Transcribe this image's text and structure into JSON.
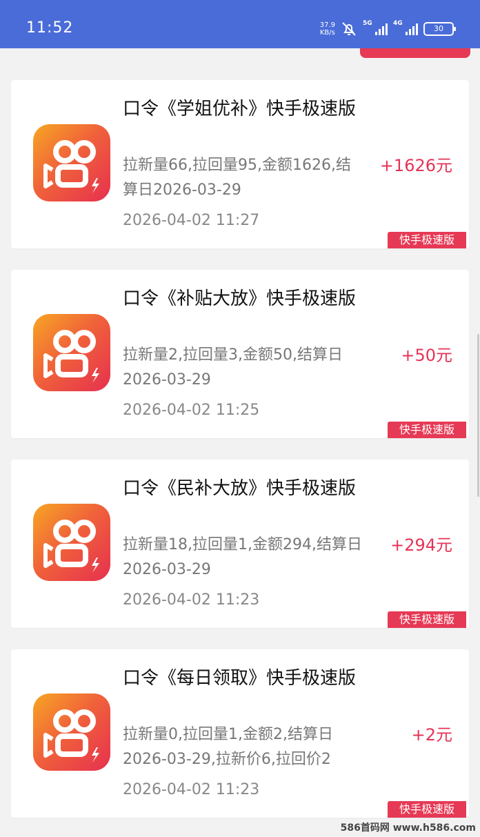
{
  "status_bar": {
    "time": "11:52",
    "net_speed_value": "37.9",
    "net_speed_unit": "KB/s",
    "signal1": "5G",
    "signal2": "4G",
    "battery": "30"
  },
  "records": [
    {
      "title": "口令《学姐优补》快手极速版",
      "desc": "拉新量66,拉回量95,金额1626,结算日2026-03-29",
      "time": "2026-04-02 11:27",
      "amount": "+1626元",
      "tag": "快手极速版",
      "icon": "kuaishou-app-icon"
    },
    {
      "title": "口令《补贴大放》快手极速版",
      "desc": "拉新量2,拉回量3,金额50,结算日2026-03-29",
      "time": "2026-04-02 11:25",
      "amount": "+50元",
      "tag": "快手极速版",
      "icon": "kuaishou-app-icon"
    },
    {
      "title": "口令《民补大放》快手极速版",
      "desc": "拉新量18,拉回量1,金额294,结算日2026-03-29",
      "time": "2026-04-02 11:23",
      "amount": "+294元",
      "tag": "快手极速版",
      "icon": "kuaishou-app-icon"
    },
    {
      "title": "口令《每日领取》快手极速版",
      "desc": "拉新量0,拉回量1,金额2,结算日2026-03-29,拉新价6,拉回价2",
      "time": "2026-04-02 11:23",
      "amount": "+2元",
      "tag": "快手极速版",
      "icon": "kuaishou-app-icon"
    }
  ],
  "watermark": "586首码网 www.h586.com",
  "colors": {
    "status_bar": "#4a6cd8",
    "accent": "#e63955",
    "amount": "#e63355"
  }
}
